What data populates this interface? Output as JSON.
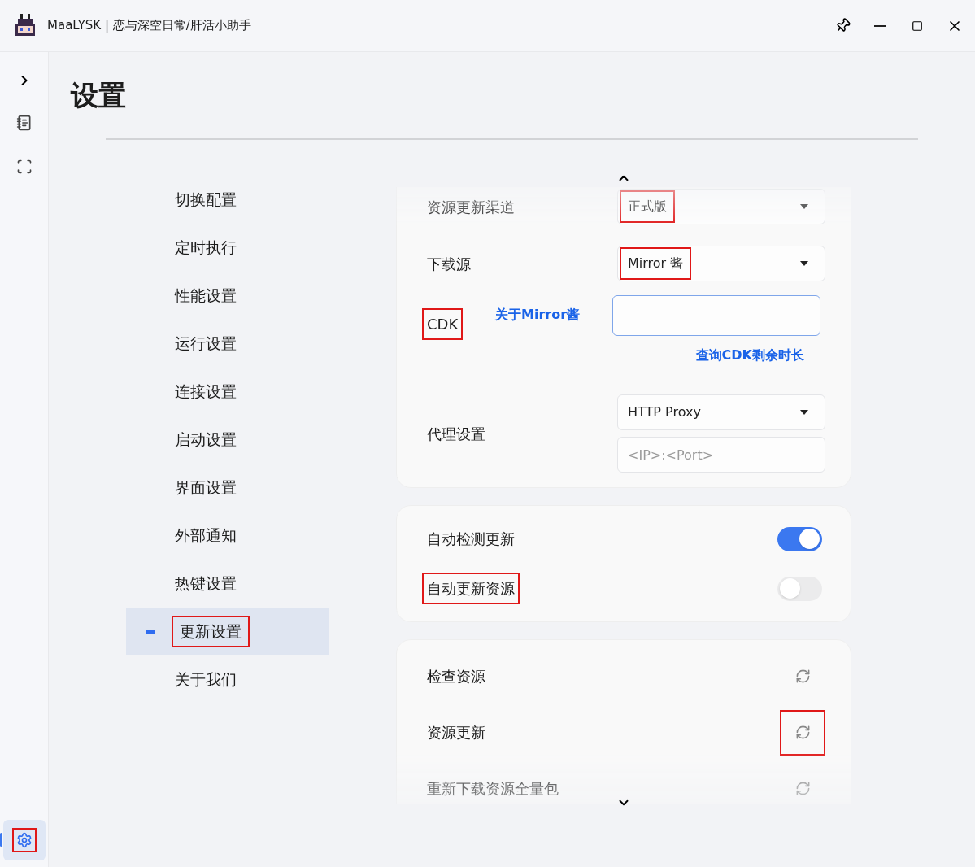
{
  "window": {
    "title": "MaaLYSK | 恋与深空日常/肝活小助手"
  },
  "rail": {
    "items": [
      {
        "selected": false
      },
      {
        "selected": false
      }
    ],
    "settings": {
      "selected": true,
      "highlighted": true
    }
  },
  "page": {
    "title": "设置"
  },
  "nav": [
    {
      "label": "切换配置",
      "selected": false,
      "highlighted": false
    },
    {
      "label": "定时执行",
      "selected": false,
      "highlighted": false
    },
    {
      "label": "性能设置",
      "selected": false,
      "highlighted": false
    },
    {
      "label": "运行设置",
      "selected": false,
      "highlighted": false
    },
    {
      "label": "连接设置",
      "selected": false,
      "highlighted": false
    },
    {
      "label": "启动设置",
      "selected": false,
      "highlighted": false
    },
    {
      "label": "界面设置",
      "selected": false,
      "highlighted": false
    },
    {
      "label": "外部通知",
      "selected": false,
      "highlighted": false
    },
    {
      "label": "热键设置",
      "selected": false,
      "highlighted": false
    },
    {
      "label": "更新设置",
      "selected": true,
      "highlighted": true
    },
    {
      "label": "关于我们",
      "selected": false,
      "highlighted": false
    }
  ],
  "cards": [
    {
      "rows": [
        {
          "kind": "dropdown",
          "label": "资源更新渠道",
          "value": "正式版",
          "label_highlighted": false,
          "value_highlighted": true
        },
        {
          "kind": "dropdown",
          "label": "下载源",
          "value": "Mirror 酱",
          "label_highlighted": false,
          "value_highlighted": true
        },
        {
          "kind": "cdk",
          "label": "CDK",
          "label_highlighted": true,
          "link": "关于Mirror酱",
          "query_link": "查询CDK剩余时长"
        },
        {
          "kind": "proxy",
          "label": "代理设置",
          "label_highlighted": false,
          "value": "HTTP Proxy",
          "placeholder": "<IP>:<Port>"
        }
      ]
    },
    {
      "rows": [
        {
          "kind": "toggle",
          "label": "自动检测更新",
          "on": true,
          "label_highlighted": false
        },
        {
          "kind": "toggle",
          "label": "自动更新资源",
          "on": false,
          "label_highlighted": true
        }
      ]
    },
    {
      "rows": [
        {
          "kind": "action",
          "label": "检查资源",
          "label_highlighted": false,
          "action_highlighted": false
        },
        {
          "kind": "action",
          "label": "资源更新",
          "label_highlighted": false,
          "action_highlighted": true
        },
        {
          "kind": "action",
          "label": "重新下载资源全量包",
          "label_highlighted": false,
          "action_highlighted": false
        }
      ]
    }
  ]
}
